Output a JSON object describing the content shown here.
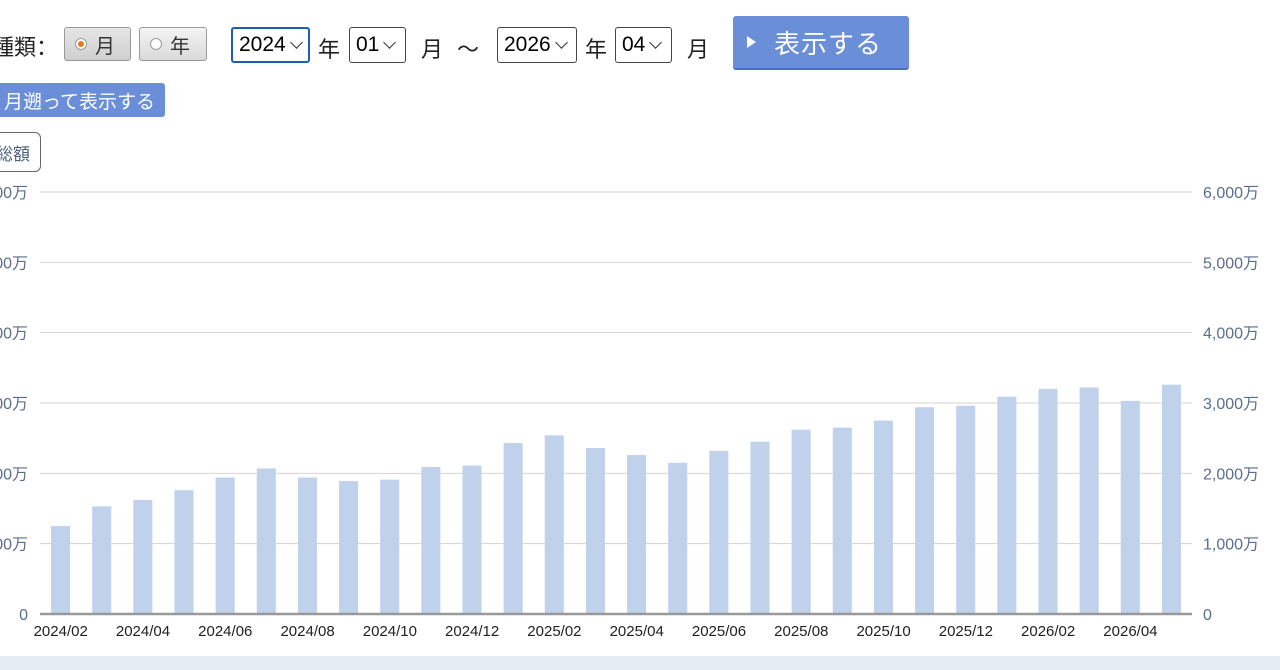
{
  "controls": {
    "type_label": "種類：",
    "radio_month": "月",
    "radio_year": "年",
    "from_year": "2024",
    "from_year_unit": "年",
    "from_month": "01",
    "from_month_unit": "月",
    "tilde": "〜",
    "to_year": "2026",
    "to_year_unit": "年",
    "to_month": "04",
    "to_month_unit": "月",
    "show_button": "表示する",
    "back_button": "月遡って表示する",
    "total_button": "総額"
  },
  "colors": {
    "bar": "#bfd1eb",
    "axis_label": "#5a6e8c",
    "grid": "#d3d3d3",
    "baseline": "#999999",
    "button": "#6a8fd8"
  },
  "chart_data": {
    "type": "bar",
    "x_ticks": [
      "2024/02",
      "2024/04",
      "2024/06",
      "2024/08",
      "2024/10",
      "2024/12",
      "2025/02",
      "2025/04",
      "2025/06",
      "2025/08",
      "2025/10",
      "2025/12",
      "2026/02",
      "2026/04"
    ],
    "values": [
      1250,
      1530,
      1620,
      1760,
      1940,
      2070,
      1940,
      1890,
      1910,
      2090,
      2110,
      2430,
      2540,
      2360,
      2260,
      2150,
      2320,
      2450,
      2620,
      2650,
      2750,
      2940,
      2960,
      3090,
      3200,
      3220,
      3030,
      3260
    ],
    "y_ticks_left": [
      "0",
      "00万",
      "00万",
      "00万",
      "00万",
      "00万",
      "00万"
    ],
    "y_ticks_right": [
      "0",
      "1,000万",
      "2,000万",
      "3,000万",
      "4,000万",
      "5,000万",
      "6,000万"
    ],
    "ylim": [
      0,
      6000
    ],
    "grid": true,
    "legend": "none"
  }
}
